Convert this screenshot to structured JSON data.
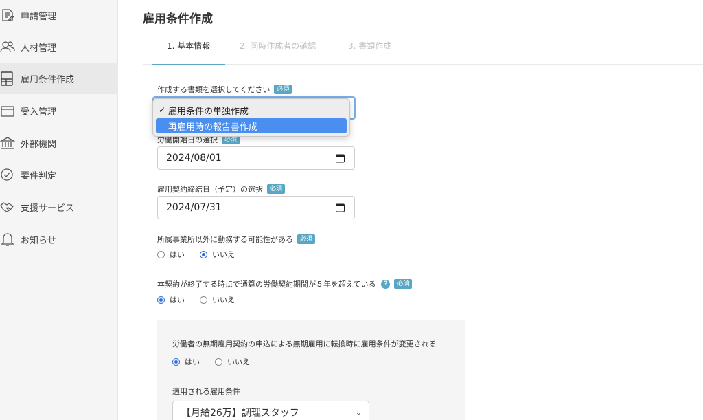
{
  "sidebar": {
    "items": [
      {
        "label": "申請管理",
        "icon": "document-edit-icon"
      },
      {
        "label": "人材管理",
        "icon": "users-icon"
      },
      {
        "label": "雇用条件作成",
        "icon": "contract-icon"
      },
      {
        "label": "受入管理",
        "icon": "calendar-icon"
      },
      {
        "label": "外部機関",
        "icon": "bank-icon"
      },
      {
        "label": "要件判定",
        "icon": "check-circle-icon"
      },
      {
        "label": "支援サービス",
        "icon": "handshake-icon"
      },
      {
        "label": "お知らせ",
        "icon": "bell-icon"
      }
    ]
  },
  "page": {
    "title": "雇用条件作成"
  },
  "steps": [
    {
      "label": "1. 基本情報"
    },
    {
      "label": "2. 同時作成者の確認"
    },
    {
      "label": "3. 書類作成"
    }
  ],
  "required_badge": "必須",
  "form": {
    "doc_select": {
      "label": "作成する書類を選択してください",
      "options": [
        "雇用条件の単独作成",
        "再雇用時の報告書作成"
      ],
      "selected": "雇用条件の単独作成",
      "hovered": "再雇用時の報告書作成"
    },
    "start_date": {
      "label": "労働開始日の選択",
      "value": "2024/08/01"
    },
    "contract_date": {
      "label": "雇用契約締結日（予定）の選択",
      "value": "2024/07/31"
    },
    "other_workplace": {
      "label": "所属事業所以外に勤務する可能性がある",
      "yes": "はい",
      "no": "いいえ",
      "selected": "no"
    },
    "over_five_years": {
      "label": "本契約が終了する時点で通算の労働契約期間が５年を超えている",
      "yes": "はい",
      "no": "いいえ",
      "selected": "yes"
    },
    "conditions_change": {
      "label": "労働者の無期雇用契約の申込による無期雇用に転換時に雇用条件が変更される",
      "yes": "はい",
      "no": "いいえ",
      "selected": "yes"
    },
    "applied_conditions": {
      "label": "適用される雇用条件",
      "value": "【月給26万】調理スタッフ"
    }
  },
  "colors": {
    "accent": "#5aa7c5",
    "radio": "#2f6fd6",
    "highlight": "#4a8ff0"
  }
}
